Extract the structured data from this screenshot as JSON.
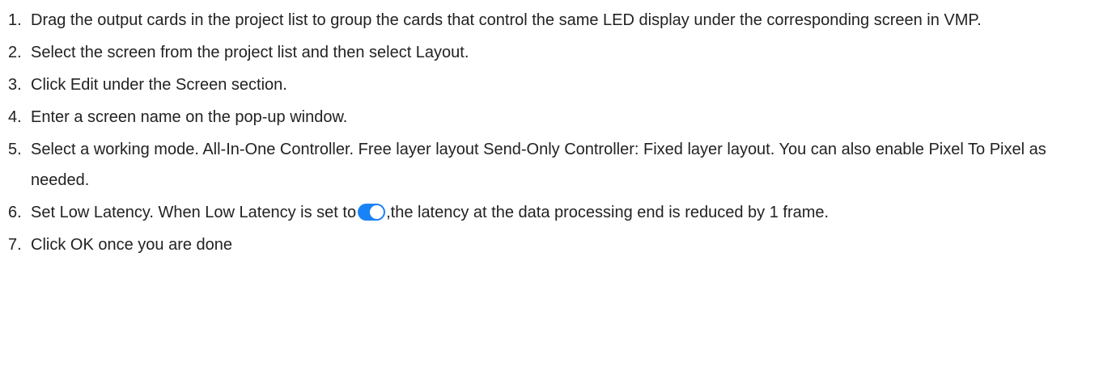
{
  "steps": [
    {
      "num": "1.",
      "text": "Drag the output cards in the project list to group the cards that control the same LED display under the corresponding screen in VMP."
    },
    {
      "num": "2.",
      "text": "Select the screen from the project list and then select Layout."
    },
    {
      "num": "3.",
      "text": "Click Edit under the Screen section."
    },
    {
      "num": "4.",
      "text": "Enter a screen name on the pop-up window."
    },
    {
      "num": "5.",
      "text": "Select a working mode. All-In-One Controller. Free layer layout Send-Only Controller: Fixed layer layout. You can also enable Pixel To Pixel as needed."
    },
    {
      "num": "6.",
      "text_before": "Set Low Latency. When Low Latency is set to",
      "text_after": ",the latency at the data processing end is reduced by 1 frame."
    },
    {
      "num": "7.",
      "text": "Click OK once you are done"
    }
  ],
  "colors": {
    "toggle_on": "#1a82f7",
    "text": "#222222"
  },
  "icons": {
    "toggle": "toggle-switch-on-icon"
  }
}
